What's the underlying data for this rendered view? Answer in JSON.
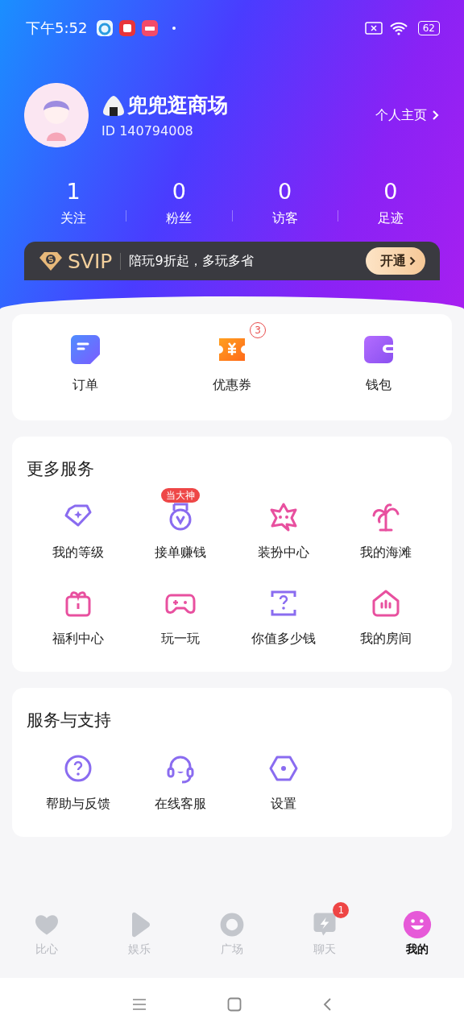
{
  "status_bar": {
    "time": "下午5:52",
    "battery": "62"
  },
  "profile": {
    "name": "兜兜逛商场",
    "id": "ID 140794008",
    "homepage_link": "个人主页"
  },
  "stats": [
    {
      "value": "1",
      "label": "关注"
    },
    {
      "value": "0",
      "label": "粉丝"
    },
    {
      "value": "0",
      "label": "访客"
    },
    {
      "value": "0",
      "label": "足迹"
    }
  ],
  "svip_banner": {
    "title": "SVIP",
    "text": "陪玩9折起，多玩多省",
    "button": "开通"
  },
  "quick_actions": [
    {
      "label": "订单"
    },
    {
      "label": "优惠券",
      "badge": "3"
    },
    {
      "label": "钱包"
    }
  ],
  "more_services": {
    "title": "更多服务",
    "items": [
      {
        "label": "我的等级"
      },
      {
        "label": "接单赚钱",
        "tag": "当大神"
      },
      {
        "label": "装扮中心"
      },
      {
        "label": "我的海滩"
      },
      {
        "label": "福利中心"
      },
      {
        "label": "玩一玩"
      },
      {
        "label": "你值多少钱"
      },
      {
        "label": "我的房间"
      }
    ]
  },
  "support": {
    "title": "服务与支持",
    "items": [
      {
        "label": "帮助与反馈"
      },
      {
        "label": "在线客服"
      },
      {
        "label": "设置"
      }
    ]
  },
  "bottom_nav": [
    {
      "label": "比心",
      "selected": false
    },
    {
      "label": "娱乐",
      "selected": false
    },
    {
      "label": "广场",
      "selected": false
    },
    {
      "label": "聊天",
      "selected": false,
      "badge": "1"
    },
    {
      "label": "我的",
      "selected": true
    }
  ]
}
